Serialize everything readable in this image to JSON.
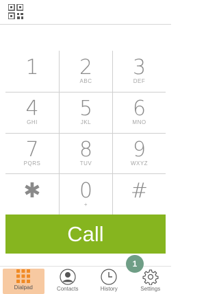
{
  "keypad": [
    {
      "digit": "1",
      "letters": ""
    },
    {
      "digit": "2",
      "letters": "ABC"
    },
    {
      "digit": "3",
      "letters": "DEF"
    },
    {
      "digit": "4",
      "letters": "GHI"
    },
    {
      "digit": "5",
      "letters": "JKL"
    },
    {
      "digit": "6",
      "letters": "MNO"
    },
    {
      "digit": "7",
      "letters": "PQRS"
    },
    {
      "digit": "8",
      "letters": "TUV"
    },
    {
      "digit": "9",
      "letters": "WXYZ"
    },
    {
      "digit": "✱",
      "letters": ""
    },
    {
      "digit": "0",
      "letters": "+"
    },
    {
      "digit": "#",
      "letters": ""
    }
  ],
  "call_button": {
    "label": "Call",
    "color": "#86b51f"
  },
  "tabs": [
    {
      "label": "Dialpad",
      "icon": "dialpad-icon",
      "active": true
    },
    {
      "label": "Contacts",
      "icon": "contact-icon",
      "active": false
    },
    {
      "label": "History",
      "icon": "clock-icon",
      "active": false
    },
    {
      "label": "Settings",
      "icon": "gear-icon",
      "active": false
    }
  ],
  "badge": {
    "count": "1",
    "color": "#6f9e86"
  },
  "colors": {
    "active_tab": "#f7c9a1",
    "dialpad_icon": "#f08a24"
  }
}
